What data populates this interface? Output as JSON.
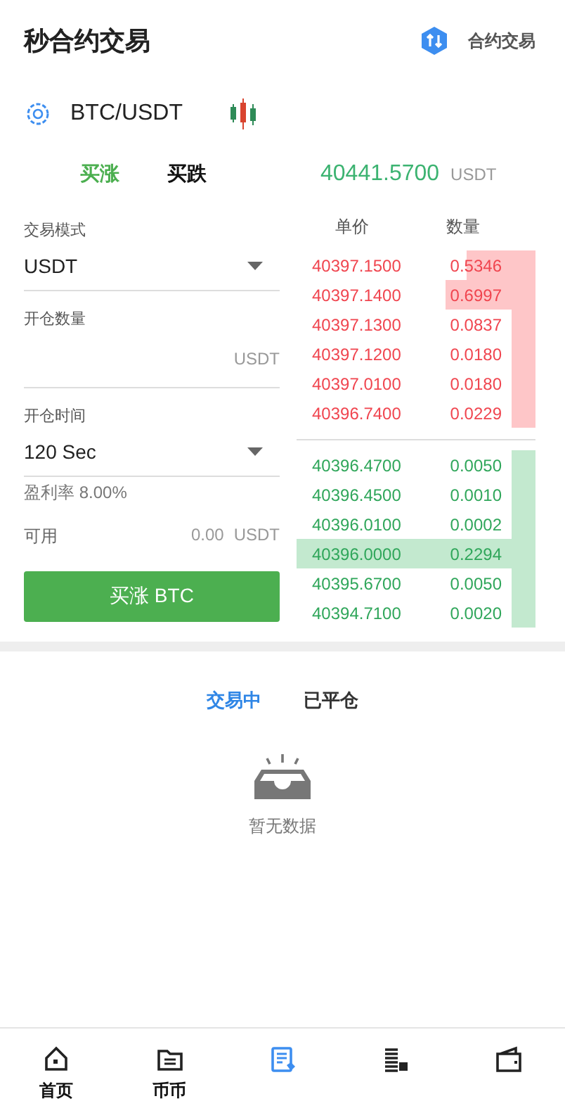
{
  "header": {
    "title": "秒合约交易",
    "switch_label": "合约交易"
  },
  "pair": {
    "symbol": "BTC/USDT"
  },
  "side_tabs": [
    {
      "label": "买涨",
      "selected": true
    },
    {
      "label": "买跌",
      "selected": false
    }
  ],
  "price": {
    "value": "40441.5700",
    "unit": "USDT"
  },
  "form": {
    "mode_label": "交易模式",
    "mode_value": "USDT",
    "amount_label": "开仓数量",
    "amount_unit": "USDT",
    "time_label": "开仓时间",
    "time_value": "120 Sec",
    "profit_rate": "盈利率 8.00%",
    "available_label": "可用",
    "available_value": "0.00",
    "available_unit": "USDT",
    "submit": "买涨 BTC"
  },
  "book": {
    "columns": [
      "单价",
      "数量"
    ],
    "asks": [
      {
        "price": "40397.1500",
        "amount": "0.5346",
        "highlighted": false
      },
      {
        "price": "40397.1400",
        "amount": "0.6997",
        "highlighted": false
      },
      {
        "price": "40397.1300",
        "amount": "0.0837",
        "highlighted": false
      },
      {
        "price": "40397.1200",
        "amount": "0.0180",
        "highlighted": false
      },
      {
        "price": "40397.0100",
        "amount": "0.0180",
        "highlighted": false
      },
      {
        "price": "40396.7400",
        "amount": "0.0229",
        "highlighted": false
      }
    ],
    "bids": [
      {
        "price": "40396.4700",
        "amount": "0.0050",
        "highlighted": false
      },
      {
        "price": "40396.4500",
        "amount": "0.0010",
        "highlighted": false
      },
      {
        "price": "40396.0100",
        "amount": "0.0002",
        "highlighted": false
      },
      {
        "price": "40396.0000",
        "amount": "0.2294",
        "highlighted": true
      },
      {
        "price": "40395.6700",
        "amount": "0.0050",
        "highlighted": false
      },
      {
        "price": "40394.7100",
        "amount": "0.0020",
        "highlighted": false
      }
    ]
  },
  "order_tabs": [
    {
      "label": "交易中",
      "selected": true
    },
    {
      "label": "已平仓",
      "selected": false
    }
  ],
  "empty_text": "暂无数据",
  "nav": [
    {
      "kind": "home",
      "label": "首页",
      "selected": false
    },
    {
      "kind": "exchange",
      "label": "币币",
      "selected": false
    },
    {
      "kind": "contract",
      "selected": true
    },
    {
      "kind": "stack",
      "selected": false
    },
    {
      "kind": "wallet",
      "selected": false
    }
  ]
}
